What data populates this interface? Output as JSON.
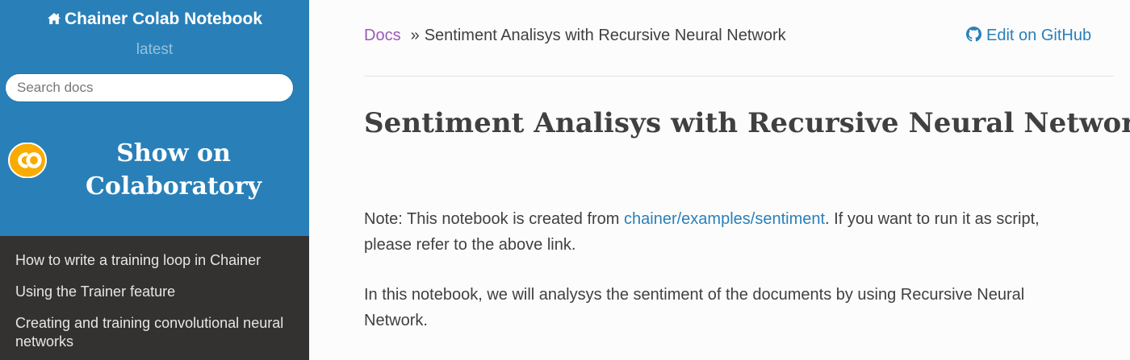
{
  "sidebar": {
    "project_name": "Chainer Colab Notebook",
    "version": "latest",
    "search": {
      "placeholder": "Search docs",
      "value": ""
    },
    "colab_button": {
      "line1": "Show on",
      "line2": "Colaboratory"
    },
    "nav_items": [
      {
        "label": "How to write a training loop in Chainer"
      },
      {
        "label": "Using the Trainer feature"
      },
      {
        "label": "Creating and training convolutional neural networks"
      }
    ]
  },
  "header": {
    "breadcrumb_root": "Docs",
    "breadcrumb_separator": "»",
    "breadcrumb_current": "Sentiment Analisys with Recursive Neural Network",
    "edit_link": "Edit on GitHub"
  },
  "main": {
    "title": "Sentiment Analisys with Recursive Neural Network",
    "paragraph1": {
      "prefix": "Note: This notebook is created from ",
      "link": "chainer/examples/sentiment",
      "suffix": ". If you want to run it as script, please refer to the above link."
    },
    "paragraph2": "In this notebook, we will analysys the sentiment of the documents by using Recursive Neural Network."
  },
  "colors": {
    "sidebar_top": "#2980b9",
    "sidebar_dark": "#343131",
    "link": "#2980b9",
    "visited_link": "#9b59b6",
    "text": "#404040",
    "colab_logo_yellow": "#f9ab00"
  },
  "icons": {
    "home": "home-icon",
    "github": "github-icon",
    "colab": "colab-logo-icon"
  }
}
